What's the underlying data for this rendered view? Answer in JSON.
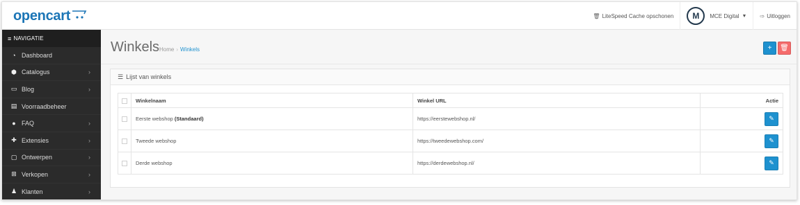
{
  "header": {
    "logo_text": "opencart",
    "cache_label": "LiteSpeed Cache opschonen",
    "user_name": "MCE Digital",
    "avatar_letter": "M",
    "logout_label": "Uitloggen"
  },
  "sidebar": {
    "heading": "NAVIGATIE",
    "items": [
      {
        "label": "Dashboard",
        "icon": "tachometer-icon",
        "has_children": false
      },
      {
        "label": "Catalogus",
        "icon": "tag-icon",
        "has_children": true
      },
      {
        "label": "Blog",
        "icon": "folder-icon",
        "has_children": true
      },
      {
        "label": "Voorraadbeheer",
        "icon": "table-icon",
        "has_children": false
      },
      {
        "label": "FAQ",
        "icon": "question-icon",
        "has_children": true
      },
      {
        "label": "Extensies",
        "icon": "puzzle-icon",
        "has_children": true
      },
      {
        "label": "Ontwerpen",
        "icon": "monitor-icon",
        "has_children": true
      },
      {
        "label": "Verkopen",
        "icon": "cart-icon",
        "has_children": true
      },
      {
        "label": "Klanten",
        "icon": "user-icon",
        "has_children": true
      }
    ]
  },
  "page": {
    "title": "Winkels",
    "breadcrumb": {
      "home": "Home",
      "sep": "›",
      "current": "Winkels"
    }
  },
  "panel": {
    "title": "Lijst van winkels",
    "columns": {
      "name": "Winkelnaam",
      "url": "Winkel URL",
      "action": "Actie"
    },
    "rows": [
      {
        "name": "Eerste webshop",
        "default_tag": "(Standaard)",
        "url": "https://eerstewebshop.nl/"
      },
      {
        "name": "Tweede webshop",
        "default_tag": "",
        "url": "https://tweedewebshop.com/"
      },
      {
        "name": "Derde webshop",
        "default_tag": "",
        "url": "https://derdewebshop.nl/"
      }
    ]
  },
  "colors": {
    "primary": "#1e91cf",
    "danger": "#f56b6b",
    "sidebar": "#2b2b2b"
  }
}
